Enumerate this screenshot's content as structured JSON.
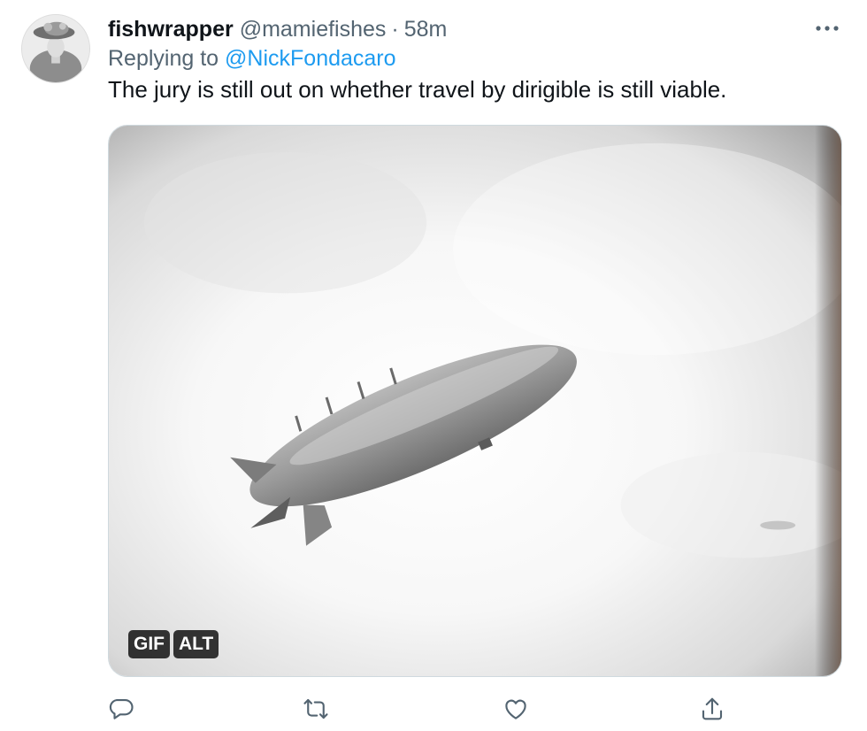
{
  "tweet": {
    "display_name": "fishwrapper",
    "handle": "@mamiefishes",
    "separator": "·",
    "timestamp": "58m",
    "replying_label": "Replying to",
    "replying_to": "@NickFondacaro",
    "text": "The jury is still out on whether travel by dirigible is still viable."
  },
  "media": {
    "gif_badge": "GIF",
    "alt_badge": "ALT"
  },
  "icons": {
    "more": "more-icon",
    "reply": "reply-icon",
    "retweet": "retweet-icon",
    "like": "heart-icon",
    "share": "share-icon"
  },
  "colors": {
    "link": "#1d9bf0",
    "secondary_text": "#536471",
    "primary_text": "#0f1419",
    "icon": "#536471"
  }
}
